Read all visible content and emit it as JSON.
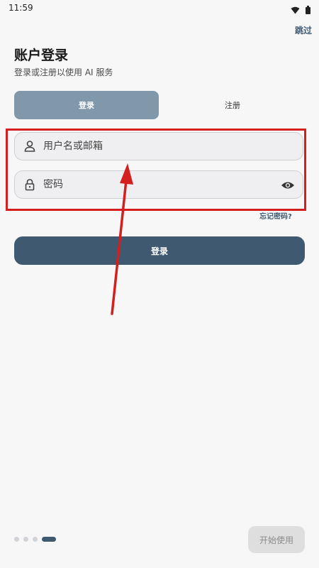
{
  "status_bar": {
    "time": "11:59",
    "icons": [
      "wifi-icon",
      "battery-icon"
    ]
  },
  "header": {
    "skip_label": "跳过",
    "title": "账户登录",
    "subtitle": "登录或注册以使用 AI 服务"
  },
  "tabs": [
    {
      "label": "登录",
      "active": true
    },
    {
      "label": "注册",
      "active": false
    }
  ],
  "form": {
    "username": {
      "placeholder": "用户名或邮箱",
      "value": "",
      "icon": "person-icon"
    },
    "password": {
      "placeholder": "密码",
      "value": "",
      "icon": "lock-icon",
      "toggle_icon": "eye-icon"
    },
    "forgot_label": "忘记密码?",
    "submit_label": "登录"
  },
  "onboarding": {
    "page_count": 4,
    "active_index": 3,
    "start_label": "开始使用"
  },
  "colors": {
    "primary": "#3f5a70",
    "tab_active": "#8197aa",
    "annotation": "#d41f1f"
  }
}
